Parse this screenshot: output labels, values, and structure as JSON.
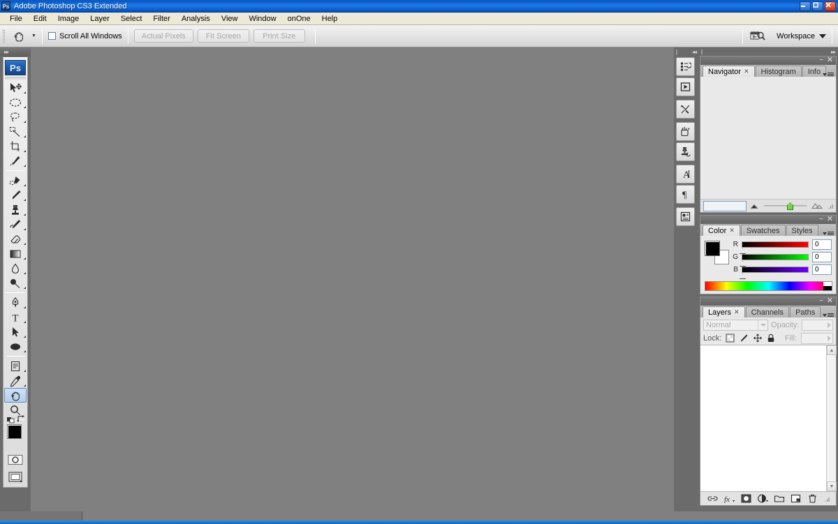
{
  "window": {
    "title": "Adobe Photoshop CS3 Extended",
    "app_badge": "Ps",
    "buttons": {
      "minimize": "_",
      "maximize": "❐",
      "close": "✕"
    }
  },
  "menubar": {
    "items": [
      {
        "label": "File",
        "accel": "F"
      },
      {
        "label": "Edit",
        "accel": "E"
      },
      {
        "label": "Image",
        "accel": "I"
      },
      {
        "label": "Layer",
        "accel": "L"
      },
      {
        "label": "Select",
        "accel": "S"
      },
      {
        "label": "Filter",
        "accel": "t"
      },
      {
        "label": "Analysis",
        "accel": "A"
      },
      {
        "label": "View",
        "accel": "V"
      },
      {
        "label": "Window",
        "accel": "W"
      },
      {
        "label": "onOne",
        "accel": "O"
      },
      {
        "label": "Help",
        "accel": "H"
      }
    ]
  },
  "options_bar": {
    "active_tool_icon": "hand-tool-icon",
    "scroll_all_windows": {
      "label": "Scroll All Windows",
      "checked": false
    },
    "buttons": [
      {
        "label": "Actual Pixels",
        "enabled": false
      },
      {
        "label": "Fit Screen",
        "enabled": false
      },
      {
        "label": "Print Size",
        "enabled": false
      }
    ],
    "bridge_icon": "go-to-bridge-icon",
    "bridge_badge": "Br",
    "workspace": {
      "label": "Workspace"
    }
  },
  "toolbox": {
    "logo": "Ps",
    "collapse_arrows": "▸▸",
    "tools": [
      {
        "name": "move-tool",
        "has_flyout": true
      },
      {
        "name": "elliptical-marquee-tool",
        "has_flyout": true
      },
      {
        "name": "lasso-tool",
        "has_flyout": true
      },
      {
        "name": "magic-wand-tool",
        "has_flyout": true
      },
      {
        "name": "crop-tool",
        "has_flyout": true
      },
      {
        "name": "slice-tool",
        "has_flyout": true
      },
      {
        "name": "healing-brush-tool",
        "has_flyout": true
      },
      {
        "name": "brush-tool",
        "has_flyout": true
      },
      {
        "name": "clone-stamp-tool",
        "has_flyout": true
      },
      {
        "name": "history-brush-tool",
        "has_flyout": true
      },
      {
        "name": "eraser-tool",
        "has_flyout": true
      },
      {
        "name": "gradient-tool",
        "has_flyout": true
      },
      {
        "name": "blur-tool",
        "has_flyout": true
      },
      {
        "name": "dodge-tool",
        "has_flyout": true
      },
      {
        "name": "pen-tool",
        "has_flyout": true
      },
      {
        "name": "horizontal-type-tool",
        "has_flyout": true
      },
      {
        "name": "path-selection-tool",
        "has_flyout": true
      },
      {
        "name": "ellipse-shape-tool",
        "has_flyout": true
      },
      {
        "name": "notes-tool",
        "has_flyout": true
      },
      {
        "name": "eyedropper-tool",
        "has_flyout": true
      },
      {
        "name": "hand-tool",
        "has_flyout": false,
        "selected": true
      },
      {
        "name": "zoom-tool",
        "has_flyout": false
      }
    ],
    "colors": {
      "foreground": "#000000",
      "background": "#ffffff"
    },
    "quick_mask": "quick-mask-mode-icon",
    "screen_mode": "screen-mode-icon"
  },
  "icon_dock": {
    "groups": [
      [
        {
          "name": "history-panel-icon"
        },
        {
          "name": "actions-panel-icon"
        }
      ],
      [
        {
          "name": "tool-presets-panel-icon"
        }
      ],
      [
        {
          "name": "brushes-panel-icon"
        },
        {
          "name": "clone-source-panel-icon"
        }
      ],
      [
        {
          "name": "character-panel-icon"
        },
        {
          "name": "paragraph-panel-icon"
        }
      ],
      [
        {
          "name": "layer-comps-panel-icon"
        }
      ]
    ]
  },
  "panels": {
    "navigator": {
      "tabs": [
        {
          "label": "Navigator",
          "active": true,
          "closable": true
        },
        {
          "label": "Histogram",
          "active": false,
          "closable": false
        },
        {
          "label": "Info",
          "active": false,
          "closable": false
        }
      ],
      "zoom_value": "",
      "zoom_placeholder": "",
      "slider_percent": 54
    },
    "color": {
      "tabs": [
        {
          "label": "Color",
          "active": true,
          "closable": true
        },
        {
          "label": "Swatches",
          "active": false,
          "closable": false
        },
        {
          "label": "Styles",
          "active": false,
          "closable": false
        }
      ],
      "foreground": "#000000",
      "background": "#ffffff",
      "channels": [
        {
          "label": "R",
          "value": "0"
        },
        {
          "label": "G",
          "value": "0"
        },
        {
          "label": "B",
          "value": "0"
        }
      ]
    },
    "layers": {
      "tabs": [
        {
          "label": "Layers",
          "active": true,
          "closable": true
        },
        {
          "label": "Channels",
          "active": false,
          "closable": false
        },
        {
          "label": "Paths",
          "active": false,
          "closable": false
        }
      ],
      "blend_mode": "Normal",
      "opacity_label": "Opacity:",
      "opacity_value": "",
      "lock_label": "Lock:",
      "lock_buttons": [
        {
          "name": "lock-transparent-pixels-icon"
        },
        {
          "name": "lock-image-pixels-icon"
        },
        {
          "name": "lock-position-icon"
        },
        {
          "name": "lock-all-icon"
        }
      ],
      "fill_label": "Fill:",
      "fill_value": "",
      "layer_rows": [],
      "footer_buttons": [
        {
          "name": "link-layers-icon"
        },
        {
          "name": "layer-style-fx-icon"
        },
        {
          "name": "add-layer-mask-icon"
        },
        {
          "name": "new-adjustment-layer-icon"
        },
        {
          "name": "new-group-icon"
        },
        {
          "name": "new-layer-icon"
        },
        {
          "name": "delete-layer-icon"
        }
      ]
    }
  },
  "canvas": {
    "background_color": "#808080",
    "empty": true
  },
  "status_bar": {
    "cells": 1
  },
  "colors": {
    "titlebar_blue": "#1e7ae8",
    "canvas_gray": "#808080",
    "panel_gray": "#6b6b6b",
    "accent_green": "#76d24a"
  }
}
